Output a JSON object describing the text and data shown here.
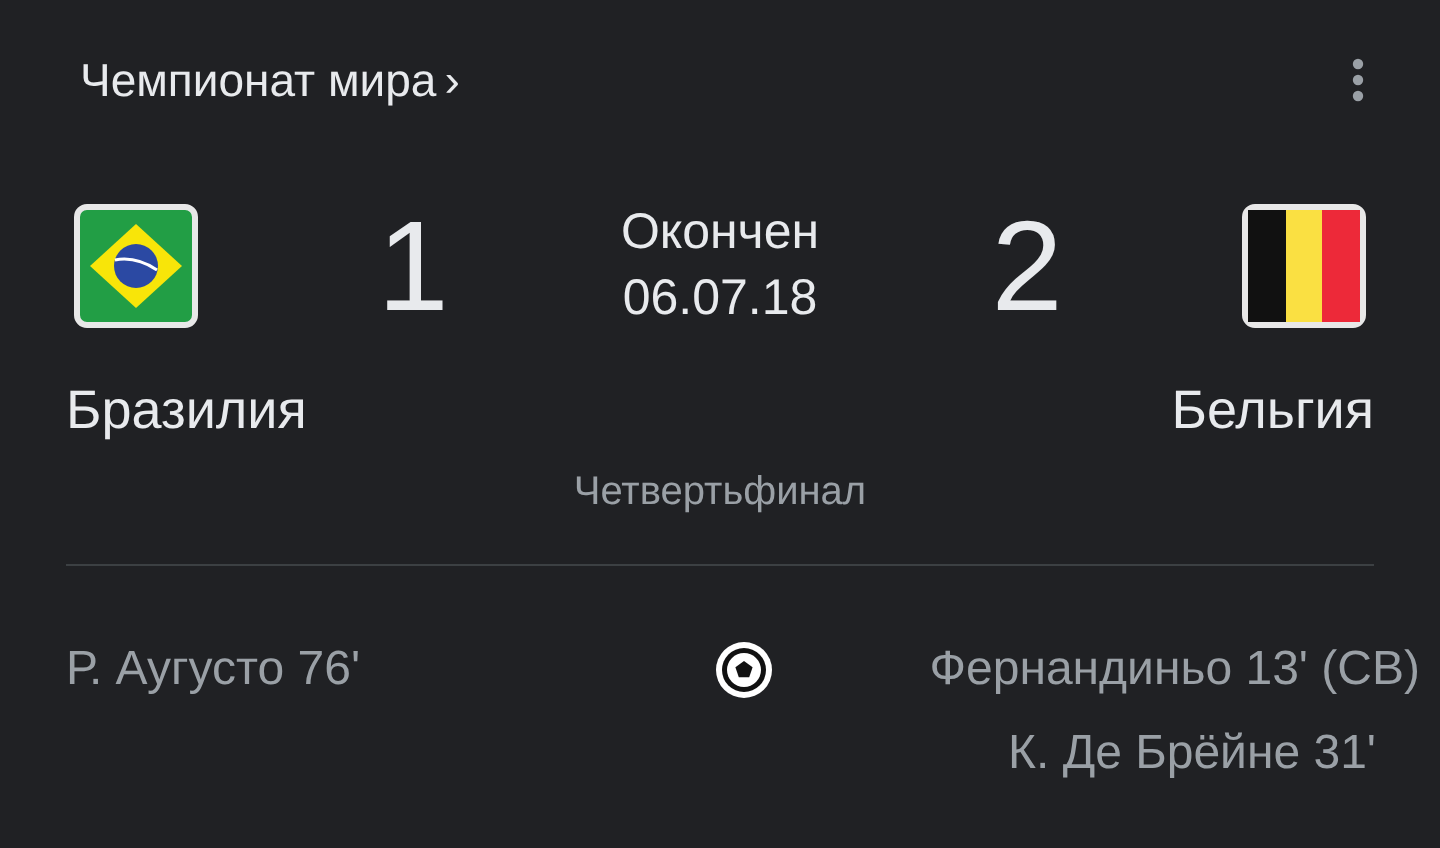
{
  "competition": {
    "title": "Чемпионат мира",
    "chevron": "›"
  },
  "teams": [
    {
      "name": "Бразилия",
      "score": "1",
      "kind": "brazil"
    },
    {
      "name": "Бельгия",
      "score": "2",
      "kind": "belgium"
    }
  ],
  "status": "Окончен",
  "date": "06.07.18",
  "stage": "Четвертьфинал",
  "goals": {
    "home": [
      "Р. Аугусто 76'"
    ],
    "away": [
      "Фернандиньо 13' (СВ)",
      "К. Де Брёйне 31'"
    ]
  }
}
